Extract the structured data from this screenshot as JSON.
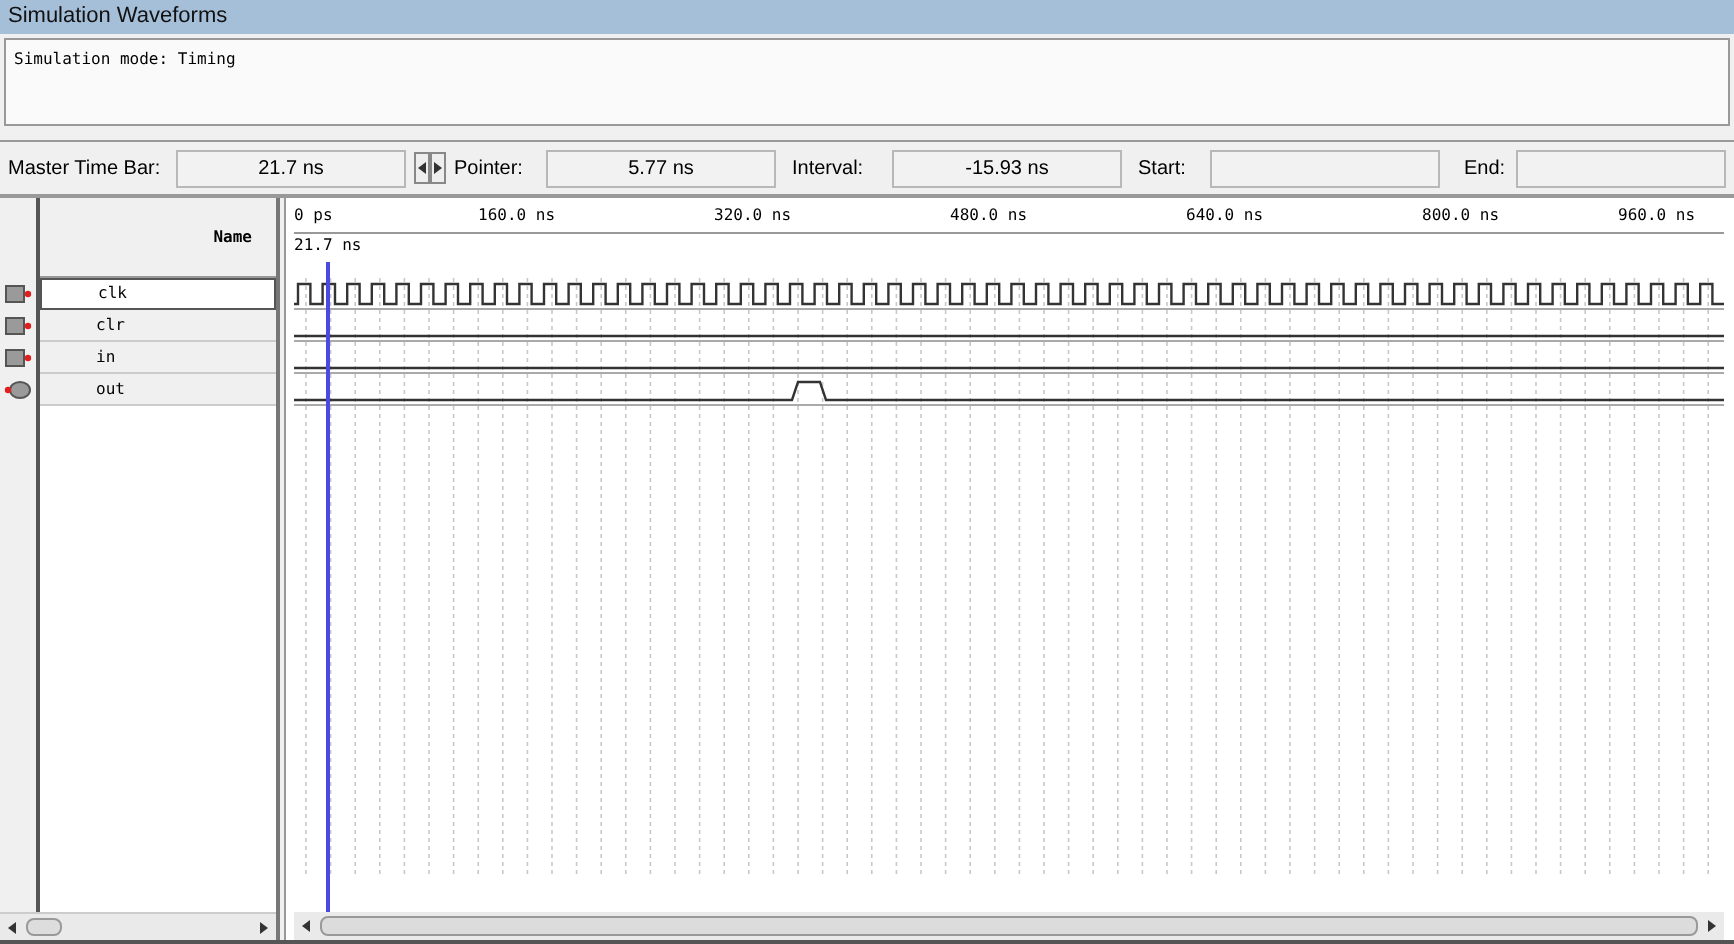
{
  "window": {
    "title": "Simulation Waveforms"
  },
  "message": "Simulation mode: Timing",
  "toolbar": {
    "master_label": "Master Time Bar:",
    "master_value": "21.7 ns",
    "pointer_label": "Pointer:",
    "pointer_value": "5.77 ns",
    "interval_label": "Interval:",
    "interval_value": "-15.93 ns",
    "start_label": "Start:",
    "end_label": "End:"
  },
  "name_header": "Name",
  "time_ticks": [
    "0 ps",
    "160.0 ns",
    "320.0 ns",
    "480.0 ns",
    "640.0 ns",
    "800.0 ns",
    "960.0 ns"
  ],
  "cursor_label": "21.7 ns",
  "signals": [
    {
      "name": "clk",
      "kind": "input",
      "selected": true
    },
    {
      "name": "clr",
      "kind": "input",
      "selected": false
    },
    {
      "name": "in",
      "kind": "input",
      "selected": false
    },
    {
      "name": "out",
      "kind": "output",
      "selected": false
    }
  ]
}
